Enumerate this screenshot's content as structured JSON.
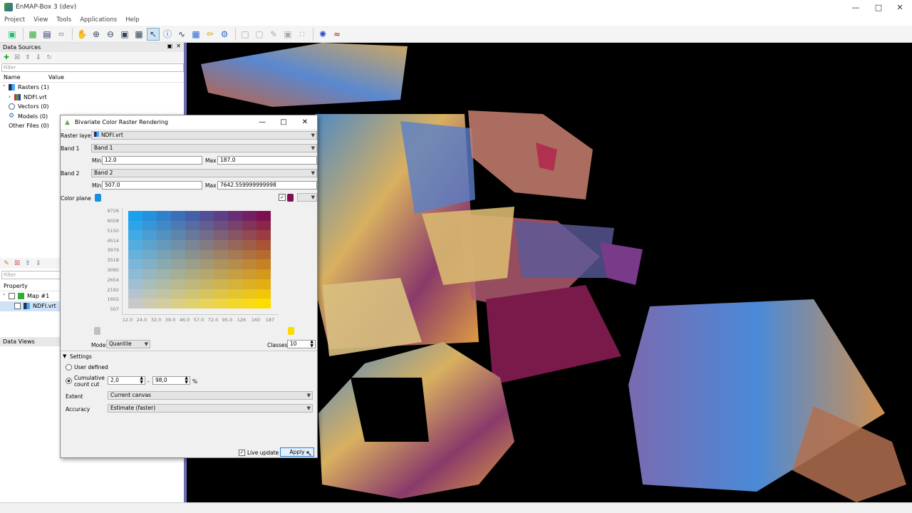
{
  "window": {
    "title": "EnMAP-Box 3 (dev)"
  },
  "menu": [
    "Project",
    "View",
    "Tools",
    "Applications",
    "Help"
  ],
  "data_sources": {
    "title": "Data Sources",
    "filter_placeholder": "Filter",
    "col_name": "Name",
    "col_value": "Value",
    "items": [
      "Rasters (1)",
      "NDFI.vrt",
      "Vectors (0)",
      "Models (0)",
      "Other Files (0)"
    ]
  },
  "data_views": {
    "title": "Data Views",
    "filter_placeholder": "Filter",
    "col_property": "Property",
    "items": [
      "Map #1",
      "NDFI.vrt"
    ]
  },
  "dialog": {
    "title": "Bivariate Color Raster Rendering",
    "raster_layer_label": "Raster layer",
    "raster_layer_value": "NDFI.vrt",
    "band1_label": "Band 1",
    "band1_value": "Band 1",
    "band1_min_label": "Min",
    "band1_min": "12.0",
    "band1_max_label": "Max",
    "band1_max": "187.0",
    "band2_label": "Band 2",
    "band2_value": "Band 2",
    "band2_min_label": "Min",
    "band2_min": "507.0",
    "band2_max_label": "Max",
    "band2_max": "7642.559999999998",
    "color_plane_label": "Color plane",
    "y_ticks": [
      "9726",
      "6028",
      "5150",
      "4514",
      "3979",
      "3518",
      "3090",
      "2654",
      "2192",
      "1602",
      "507"
    ],
    "x_ticks": [
      "12.0",
      "24.0",
      "32.0",
      "39.0",
      "46.0",
      "57.0",
      "72.0",
      "95.0",
      "126",
      "160",
      "187"
    ],
    "mode_label": "Mode",
    "mode_value": "Quantile",
    "classes_label": "Classes",
    "classes_value": "10",
    "settings_label": "Settings",
    "user_defined_label": "User defined",
    "cumulative_label_1": "Cumulative",
    "cumulative_label_2": "count cut",
    "cut_low": "2,0",
    "cut_sep": "-",
    "cut_high": "98,0",
    "cut_unit": "%",
    "extent_label": "Extent",
    "extent_value": "Current canvas",
    "accuracy_label": "Accuracy",
    "accuracy_value": "Estimate (faster)",
    "live_update_label": "Live update",
    "apply_label": "Apply"
  },
  "colors": {
    "top_left": "#1aa0ec",
    "top_right": "#7e0f52",
    "bottom_left": "#c8c8c8",
    "bottom_right": "#ffdc00",
    "accent": "#6a6fb0"
  }
}
